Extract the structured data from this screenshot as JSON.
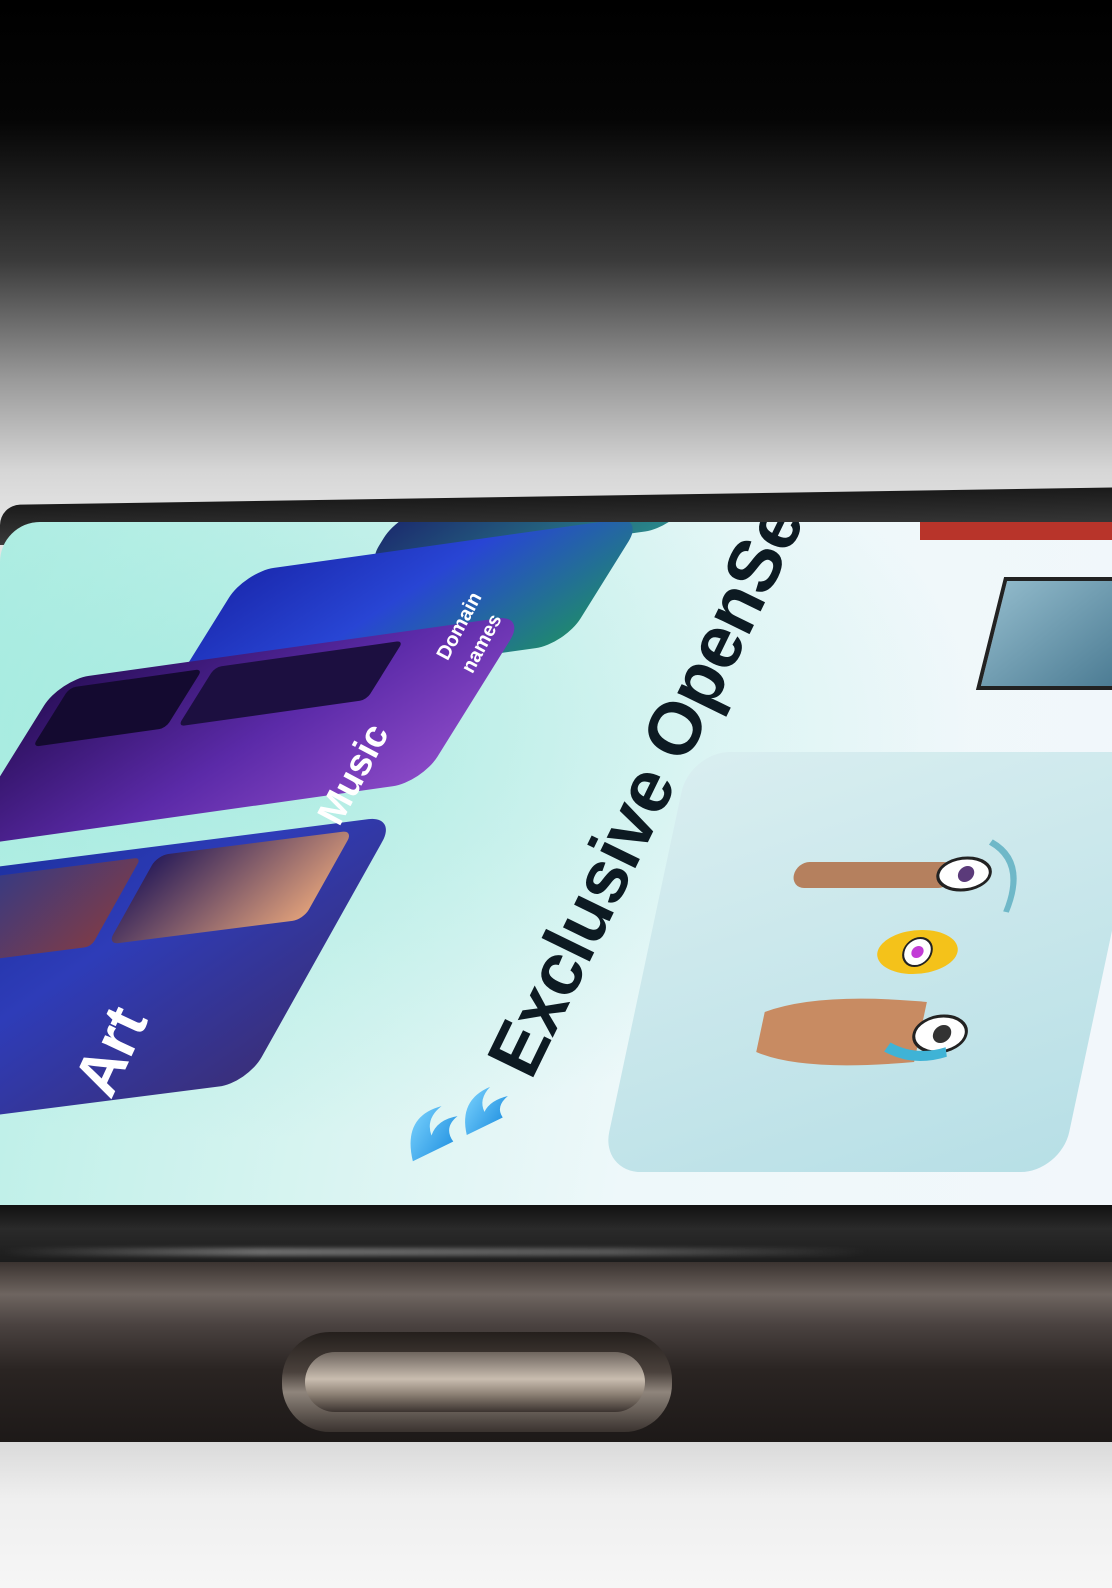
{
  "screen": {
    "heading": "Exclusive OpenSea drops",
    "categories": [
      {
        "label": "Art"
      },
      {
        "label": "Music"
      },
      {
        "label": "Domain\nnames"
      }
    ]
  }
}
